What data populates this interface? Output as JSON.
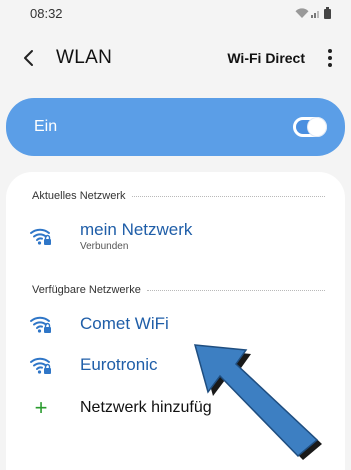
{
  "status_bar": {
    "time": "08:32"
  },
  "header": {
    "title": "WLAN",
    "wifi_direct_label": "Wi-Fi Direct"
  },
  "wlan_toggle": {
    "label": "Ein",
    "state": "on"
  },
  "current_network": {
    "section_label": "Aktuelles Netzwerk",
    "name": "mein Netzwerk",
    "status": "Verbunden"
  },
  "available_networks": {
    "section_label": "Verfügbare Netzwerke",
    "items": [
      {
        "name": "Comet WiFi"
      },
      {
        "name": "Eurotronic"
      }
    ],
    "add_label": "Netzwerk hinzufüg"
  },
  "colors": {
    "accent": "#5b9ee7",
    "network_name": "#1f5ea8",
    "add_icon": "#2a9b2e",
    "arrow_fill": "#3d7fc2"
  },
  "icons": [
    "back-arrow",
    "wifi-signal",
    "battery",
    "more-vert",
    "wifi-lock",
    "plus",
    "pointer-arrow"
  ]
}
